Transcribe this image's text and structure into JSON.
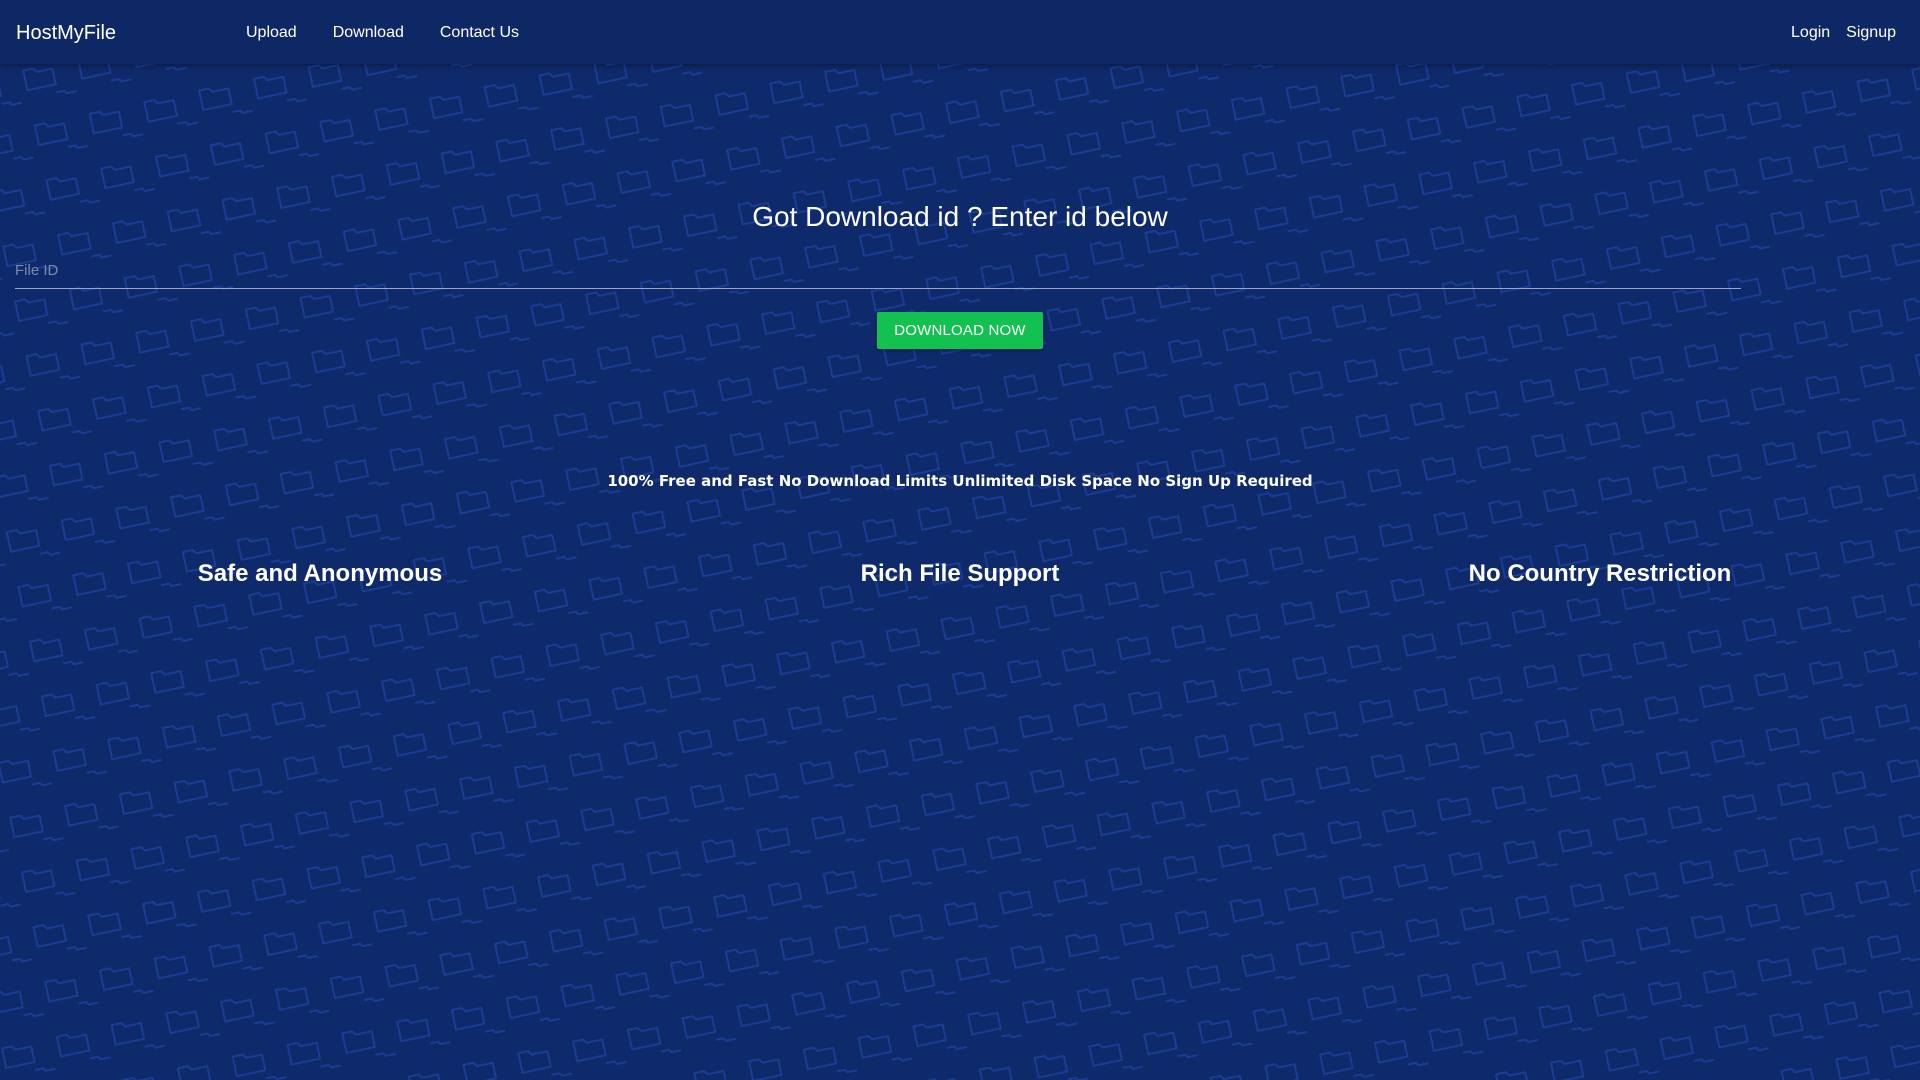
{
  "header": {
    "brand": "HostMyFile",
    "nav": [
      {
        "label": "Upload"
      },
      {
        "label": "Download"
      },
      {
        "label": "Contact Us"
      }
    ],
    "auth": [
      {
        "label": "Login"
      },
      {
        "label": "Signup"
      }
    ]
  },
  "main": {
    "headline": "Got Download id ? Enter id below",
    "file_input": {
      "placeholder": "File ID",
      "value": ""
    },
    "download_button": "DOWNLOAD NOW",
    "tagline": "100% Free and Fast No Download Limits Unlimited Disk Space No Sign Up Required",
    "features": [
      {
        "title": "Safe and Anonymous"
      },
      {
        "title": "Rich File Support"
      },
      {
        "title": "No Country Restriction"
      }
    ]
  },
  "colors": {
    "background": "#0f2a6b",
    "pattern": "#18388a",
    "button": "#12c150",
    "text": "#ffffff"
  },
  "icons": {
    "background_pattern": "folder-icon"
  }
}
